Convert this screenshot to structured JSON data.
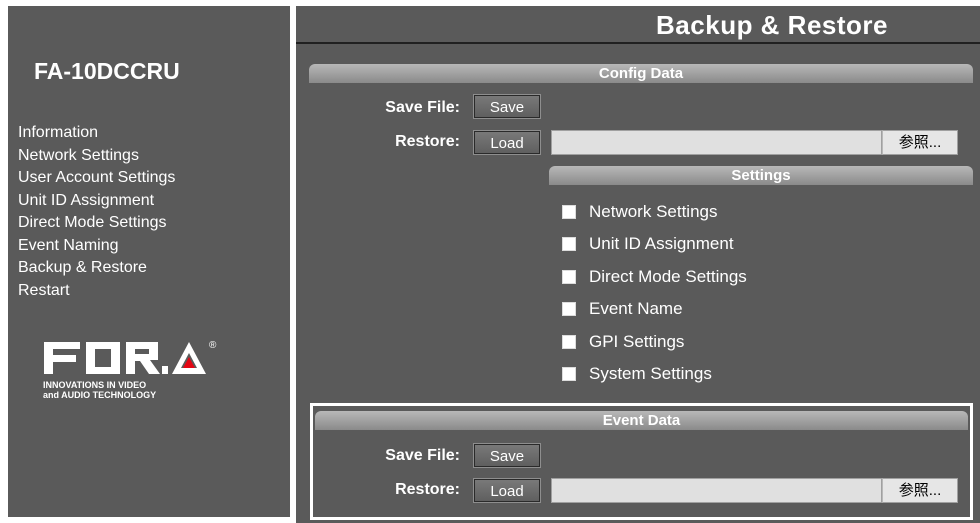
{
  "sidebar": {
    "device_name": "FA-10DCCRU",
    "nav_items": [
      {
        "label": "Information"
      },
      {
        "label": "Network Settings"
      },
      {
        "label": "User Account Settings"
      },
      {
        "label": "Unit ID Assignment"
      },
      {
        "label": "Direct Mode Settings"
      },
      {
        "label": "Event Naming"
      },
      {
        "label": "Backup & Restore"
      },
      {
        "label": "Restart"
      }
    ],
    "logo": {
      "text": "FOR-A",
      "registered": "®",
      "tagline_1": "INNOVATIONS IN VIDEO",
      "tagline_2": "and AUDIO TECHNOLOGY",
      "brand_color": "#ffffff",
      "accent_color": "#e30613"
    }
  },
  "header": {
    "title": "Backup & Restore"
  },
  "config_section": {
    "header": "Config Data",
    "save_label": "Save File:",
    "save_button": "Save",
    "restore_label": "Restore:",
    "load_button": "Load",
    "file_value": "",
    "browse_button": "参照...",
    "settings_header": "Settings",
    "settings": [
      {
        "label": "Network Settings",
        "checked": false
      },
      {
        "label": "Unit ID Assignment",
        "checked": false
      },
      {
        "label": "Direct Mode Settings",
        "checked": false
      },
      {
        "label": "Event Name",
        "checked": false
      },
      {
        "label": "GPI Settings",
        "checked": false
      },
      {
        "label": "System Settings",
        "checked": false
      }
    ]
  },
  "event_section": {
    "header": "Event Data",
    "save_label": "Save File:",
    "save_button": "Save",
    "restore_label": "Restore:",
    "load_button": "Load",
    "file_value": "",
    "browse_button": "参照..."
  },
  "colors": {
    "panel_bg": "#5a5a5a",
    "header_gradient_top": "#b8b8b8",
    "header_gradient_bottom": "#8a8a8a",
    "text": "#ffffff"
  }
}
